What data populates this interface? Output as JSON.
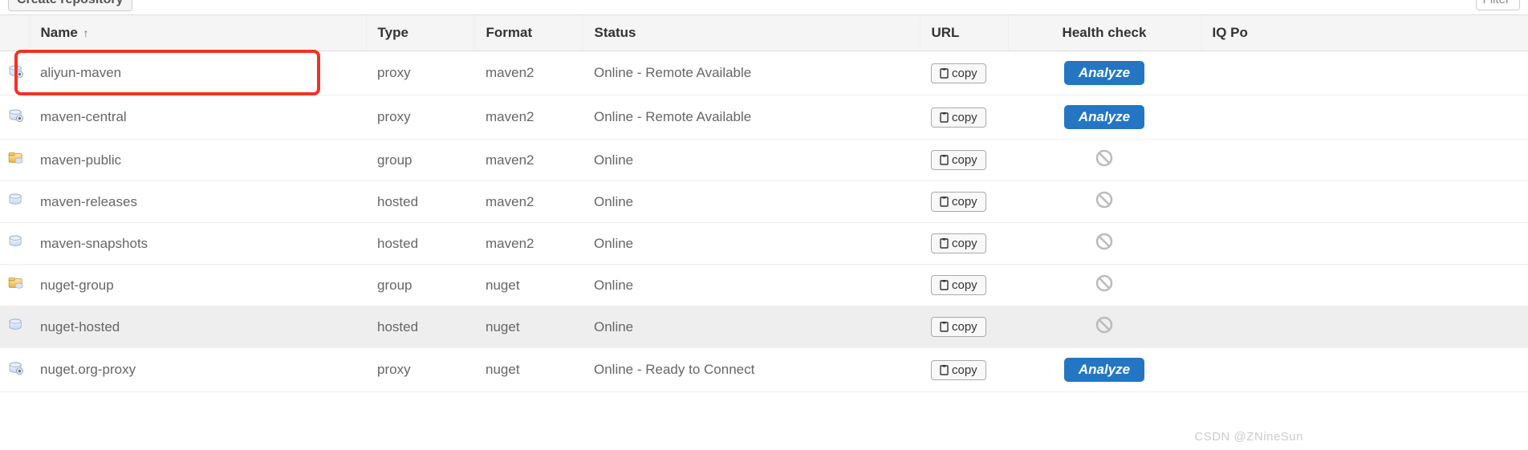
{
  "toolbar": {
    "create_label": "Create repository",
    "filter_label": "Filter"
  },
  "columns": {
    "icon": "",
    "name": "Name",
    "type": "Type",
    "format": "Format",
    "status": "Status",
    "url": "URL",
    "health": "Health check",
    "iq": "IQ Po"
  },
  "sort": {
    "column": "name",
    "direction": "asc",
    "arrow": "↑"
  },
  "buttons": {
    "copy": "copy",
    "analyze": "Analyze"
  },
  "repositories": [
    {
      "name": "aliyun-maven",
      "type": "proxy",
      "format": "maven2",
      "status": "Online - Remote Available",
      "icon": "proxy",
      "health": "analyze",
      "highlighted": true
    },
    {
      "name": "maven-central",
      "type": "proxy",
      "format": "maven2",
      "status": "Online - Remote Available",
      "icon": "proxy",
      "health": "analyze"
    },
    {
      "name": "maven-public",
      "type": "group",
      "format": "maven2",
      "status": "Online",
      "icon": "group",
      "health": "disabled"
    },
    {
      "name": "maven-releases",
      "type": "hosted",
      "format": "maven2",
      "status": "Online",
      "icon": "hosted",
      "health": "disabled"
    },
    {
      "name": "maven-snapshots",
      "type": "hosted",
      "format": "maven2",
      "status": "Online",
      "icon": "hosted",
      "health": "disabled"
    },
    {
      "name": "nuget-group",
      "type": "group",
      "format": "nuget",
      "status": "Online",
      "icon": "group",
      "health": "disabled"
    },
    {
      "name": "nuget-hosted",
      "type": "hosted",
      "format": "nuget",
      "status": "Online",
      "icon": "hosted",
      "health": "disabled",
      "hovered": true
    },
    {
      "name": "nuget.org-proxy",
      "type": "proxy",
      "format": "nuget",
      "status": "Online - Ready to Connect",
      "icon": "proxy",
      "health": "analyze"
    }
  ],
  "watermark": "CSDN @ZNineSun"
}
